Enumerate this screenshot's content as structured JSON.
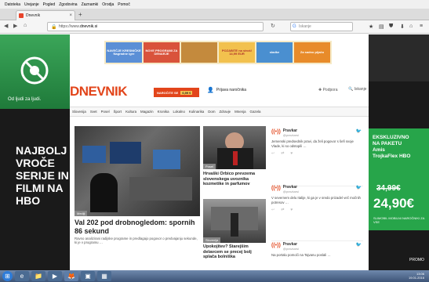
{
  "menu": [
    "Datoteka",
    "Urejanje",
    "Pogled",
    "Zgodovina",
    "Zaznamki",
    "Orodja",
    "Pomoč"
  ],
  "tab": {
    "title": "Dnevnik",
    "close": "×",
    "new": "+"
  },
  "nav_icons": {
    "back": "back-icon",
    "forward": "forward-icon",
    "home": "home-icon"
  },
  "url": {
    "prefix": "https://www.",
    "domain": "dnevnik.si"
  },
  "search": {
    "placeholder": "Iskanje"
  },
  "left_skin": {
    "tagline": "Od ljudi za ljudi.",
    "promo": [
      "NAJBOLJ",
      "VROČE",
      "SERIJE IN",
      "FILMI NA",
      "HBO"
    ]
  },
  "right_skin": {
    "promo": [
      "EKSKLUZIVNO",
      "NA PAKETU",
      "Amis",
      "TrojkaFlex HBO"
    ],
    "old_price": "34,99€",
    "new_price": "24,90€",
    "fine": "SLIMOBIL MOBILNI NAROČNIKI ZA VSE",
    "bottom": "PROMO"
  },
  "banner": [
    "NAVEČJE KRESNIČKE Nagradne igre",
    "NOVE PROGRAMI ZA DENARJE",
    "",
    "POZABITE na stroš! 14,99 EUR",
    "sladke",
    "Za sadno pijačo"
  ],
  "site": {
    "logo": "DNEVNIK",
    "subscribe": "NAROČITE SE",
    "subscribe_price": "6,99 €",
    "login": "Prijava naročnika",
    "support": "Podpora",
    "search": "Iskanje"
  },
  "sections": [
    "Slovenija",
    "Svet",
    "Posel",
    "Šport",
    "Kultura",
    "Magazin",
    "Kronika",
    "Lokalno",
    "Kulinarika",
    "Dom",
    "Zdravje",
    "Mnenja",
    "Gazela"
  ],
  "lead": {
    "tag": "Mediji",
    "title": "Val 202 pod drobnogledom: spornih 86 sekund",
    "dek": "Ravno analizirani radijske programe in predlagajo pogovor o predvajanju sekunde, ki je v programu …"
  },
  "mid1": {
    "tag": "Posel",
    "title": "Hrvaški Orbico prevzema slovenskega uvoznika kozmetike in parfumov"
  },
  "mid2": {
    "tag": "Slovenija",
    "title": "Upokojitev? Starejšim delavcem se precej bolj splača bolniška"
  },
  "cards": [
    {
      "name": "Pravkar",
      "handle": "@pravkarsi",
      "text": "Jemenski predsednik pravi, da želi pogovor s šefi svoje Vlade, ki so odstopili …"
    },
    {
      "name": "Pravkar",
      "handle": "@pravkarsi",
      "text": "V severnem delu Italije, ki ga je v sredo prizadel več močnih potresov …"
    },
    {
      "name": "Pravkar",
      "handle": "@pravkarsi",
      "text": "Na portalu pomoči na Tajvanu poslali …"
    }
  ],
  "taskbar": {
    "time": "13:06",
    "date": "19.01.2016"
  }
}
